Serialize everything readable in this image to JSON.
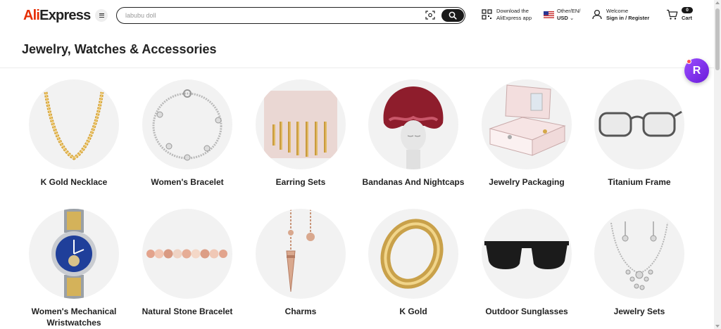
{
  "header": {
    "logo_prefix": "Ali",
    "logo_suffix": "Express",
    "search_placeholder": "labubu doll",
    "download_line1": "Download the",
    "download_line2": "AliExpress app",
    "locale_line1": "Other/EN/",
    "locale_line2": "USD",
    "welcome": "Welcome",
    "signin": "Sign in / Register",
    "cart_count": "0",
    "cart_label": "Cart"
  },
  "page_title": "Jewelry, Watches & Accessories",
  "categories": [
    {
      "label": "K Gold Necklace",
      "icon": "gold-chain-necklace"
    },
    {
      "label": "Women's Bracelet",
      "icon": "silver-bracelet"
    },
    {
      "label": "Earring Sets",
      "icon": "gold-earrings"
    },
    {
      "label": "Bandanas And Nightcaps",
      "icon": "satin-bonnet"
    },
    {
      "label": "Jewelry Packaging",
      "icon": "jewelry-box"
    },
    {
      "label": "Titanium Frame",
      "icon": "eyeglasses"
    },
    {
      "label": "Women's Mechanical Wristwatches",
      "icon": "wristwatch"
    },
    {
      "label": "Natural Stone Bracelet",
      "icon": "bead-bracelet"
    },
    {
      "label": "Charms",
      "icon": "pendulum-charm"
    },
    {
      "label": "K Gold",
      "icon": "gold-ring"
    },
    {
      "label": "Outdoor Sunglasses",
      "icon": "sunglasses"
    },
    {
      "label": "Jewelry Sets",
      "icon": "necklace-set"
    }
  ],
  "fab_letter": "R",
  "colors": {
    "accent": "#e62e04",
    "fab": "#7b2ff0"
  }
}
